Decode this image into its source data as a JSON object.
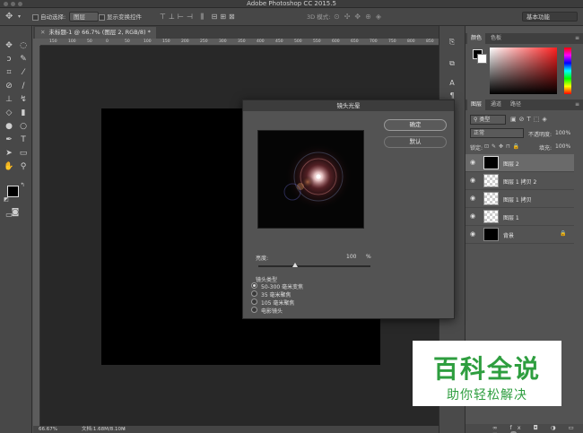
{
  "window": {
    "title": "Adobe Photoshop CC 2015.5"
  },
  "options_bar": {
    "auto_select_label": "自动选择:",
    "auto_select_value": "图层",
    "show_transform_label": "显示变换控件",
    "mode_3d_label": "3D 模式:",
    "workspace": "基本功能"
  },
  "document": {
    "tab_title": "未标题-1 @ 66.7% (图层 2, RGB/8) *",
    "ruler_ticks": [
      "150",
      "100",
      "50",
      "0",
      "50",
      "100",
      "150",
      "200",
      "250",
      "300",
      "350",
      "400",
      "450",
      "500",
      "550",
      "600",
      "650",
      "700",
      "750",
      "800",
      "850"
    ],
    "zoom": "66.67%",
    "doc_info": "文档:1.68M/8.10M"
  },
  "panels": {
    "color_tabs": [
      "颜色",
      "色板"
    ],
    "layer_tabs": [
      "图层",
      "通道",
      "路径"
    ],
    "kind_filter": "类型",
    "blend_mode": "正常",
    "opacity_label": "不透明度:",
    "opacity_value": "100%",
    "lock_label": "锁定:",
    "fill_label": "填充:",
    "fill_value": "100%",
    "layers": [
      {
        "name": "图层 2",
        "thumb": "black",
        "selected": true
      },
      {
        "name": "图层 1 拷贝 2",
        "thumb": "checker",
        "selected": false
      },
      {
        "name": "图层 1 拷贝",
        "thumb": "checker",
        "selected": false
      },
      {
        "name": "图层 1",
        "thumb": "checker",
        "selected": false
      },
      {
        "name": "背景",
        "thumb": "black",
        "selected": false
      }
    ]
  },
  "dialog": {
    "title": "镜头光晕",
    "ok": "确定",
    "default": "默认",
    "brightness_label": "亮度:",
    "brightness_value": "100",
    "brightness_unit": "%",
    "lens_type_label": "镜头类型",
    "lens_options": [
      "50-300 毫米变焦",
      "35 毫米聚焦",
      "105 毫米聚焦",
      "电影镜头"
    ],
    "selected_lens": 0,
    "brightness_fraction": 0.33
  },
  "watermark": {
    "title": "百科全说",
    "subtitle": "助你轻松解决"
  }
}
